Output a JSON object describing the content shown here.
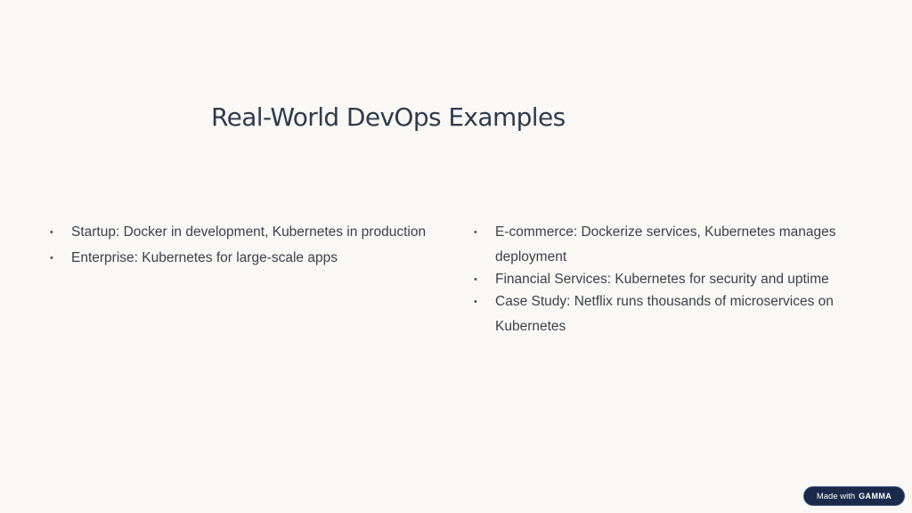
{
  "slide": {
    "title": "Real-World DevOps Examples",
    "bullet_glyph": "•",
    "left_column": [
      "Startup: Docker in development, Kubernetes in production",
      "Enterprise: Kubernetes for large-scale apps"
    ],
    "right_column": [
      "E-commerce: Dockerize services, Kubernetes manages deployment",
      "Financial Services: Kubernetes for security and uptime",
      "Case Study: Netflix runs thousands of microservices on Kubernetes"
    ]
  },
  "badge": {
    "prefix": "Made with",
    "brand": "GAMMA"
  },
  "colors": {
    "background": "#faf8f4",
    "title": "#2f3b4d",
    "body_text": "#3b4149",
    "badge_bg": "#1b2a4a"
  }
}
